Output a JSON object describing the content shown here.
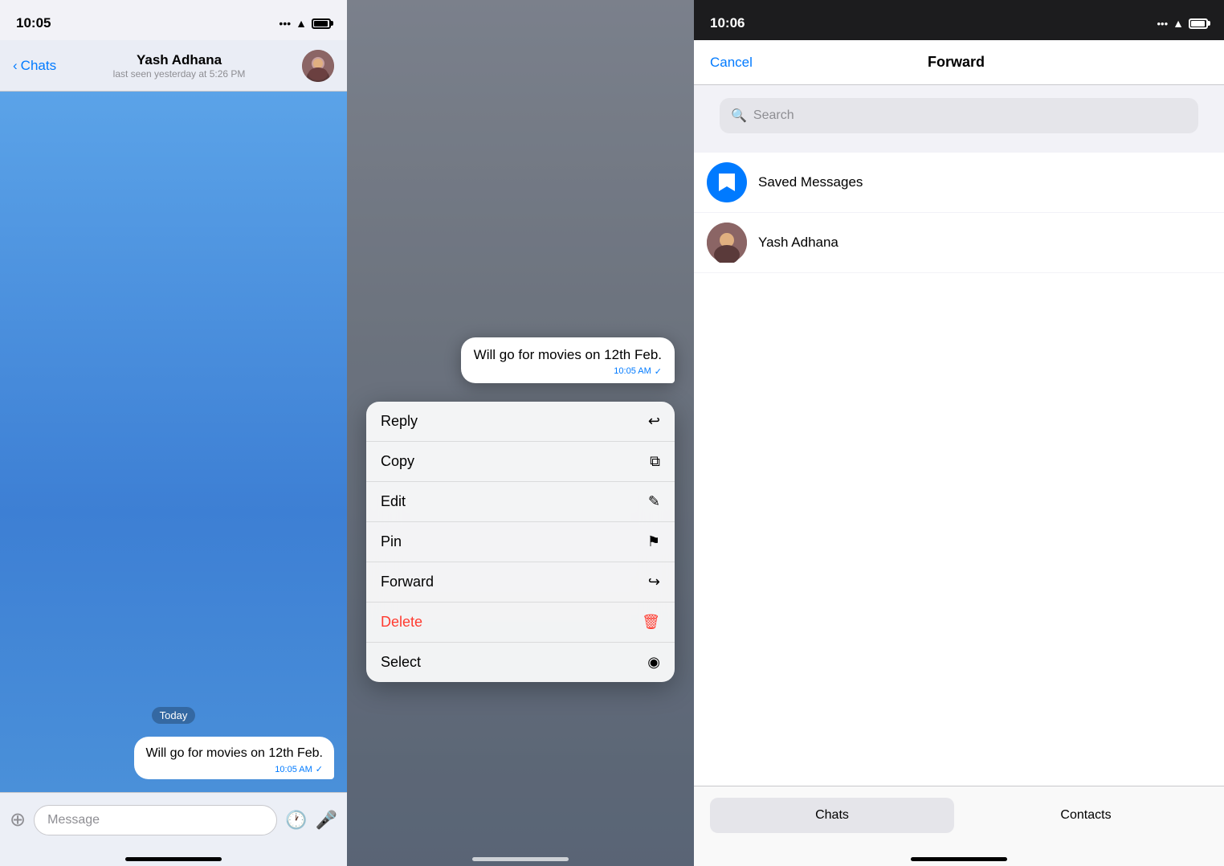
{
  "panel1": {
    "statusBar": {
      "time": "10:05"
    },
    "navBar": {
      "backLabel": "Chats",
      "contactName": "Yash Adhana",
      "contactStatus": "last seen yesterday at 5:26 PM"
    },
    "messages": {
      "dateSeparator": "Today",
      "bubble": {
        "text": "Will go for movies on 12th Feb.",
        "time": "10:05 AM",
        "checkmark": "✓"
      }
    },
    "inputBar": {
      "placeholder": "Message"
    }
  },
  "panel2": {
    "message": {
      "text": "Will go for movies on 12th Feb.",
      "time": "10:05 AM",
      "checkmark": "✓"
    },
    "contextMenu": {
      "items": [
        {
          "label": "Reply",
          "icon": "↩",
          "isDelete": false
        },
        {
          "label": "Copy",
          "icon": "⧉",
          "isDelete": false
        },
        {
          "label": "Edit",
          "icon": "✎",
          "isDelete": false
        },
        {
          "label": "Pin",
          "icon": "📌",
          "isDelete": false
        },
        {
          "label": "Forward",
          "icon": "↪",
          "isDelete": false
        },
        {
          "label": "Delete",
          "icon": "🗑",
          "isDelete": true
        },
        {
          "label": "Select",
          "icon": "◉",
          "isDelete": false
        }
      ]
    }
  },
  "panel3": {
    "statusBar": {
      "time": "10:06"
    },
    "navBar": {
      "cancelLabel": "Cancel",
      "title": "Forward"
    },
    "search": {
      "placeholder": "Search"
    },
    "contacts": [
      {
        "name": "Saved Messages",
        "avatarType": "saved"
      },
      {
        "name": "Yash Adhana",
        "avatarType": "contact"
      }
    ],
    "tabs": [
      {
        "label": "Chats",
        "active": true
      },
      {
        "label": "Contacts",
        "active": false
      }
    ]
  }
}
